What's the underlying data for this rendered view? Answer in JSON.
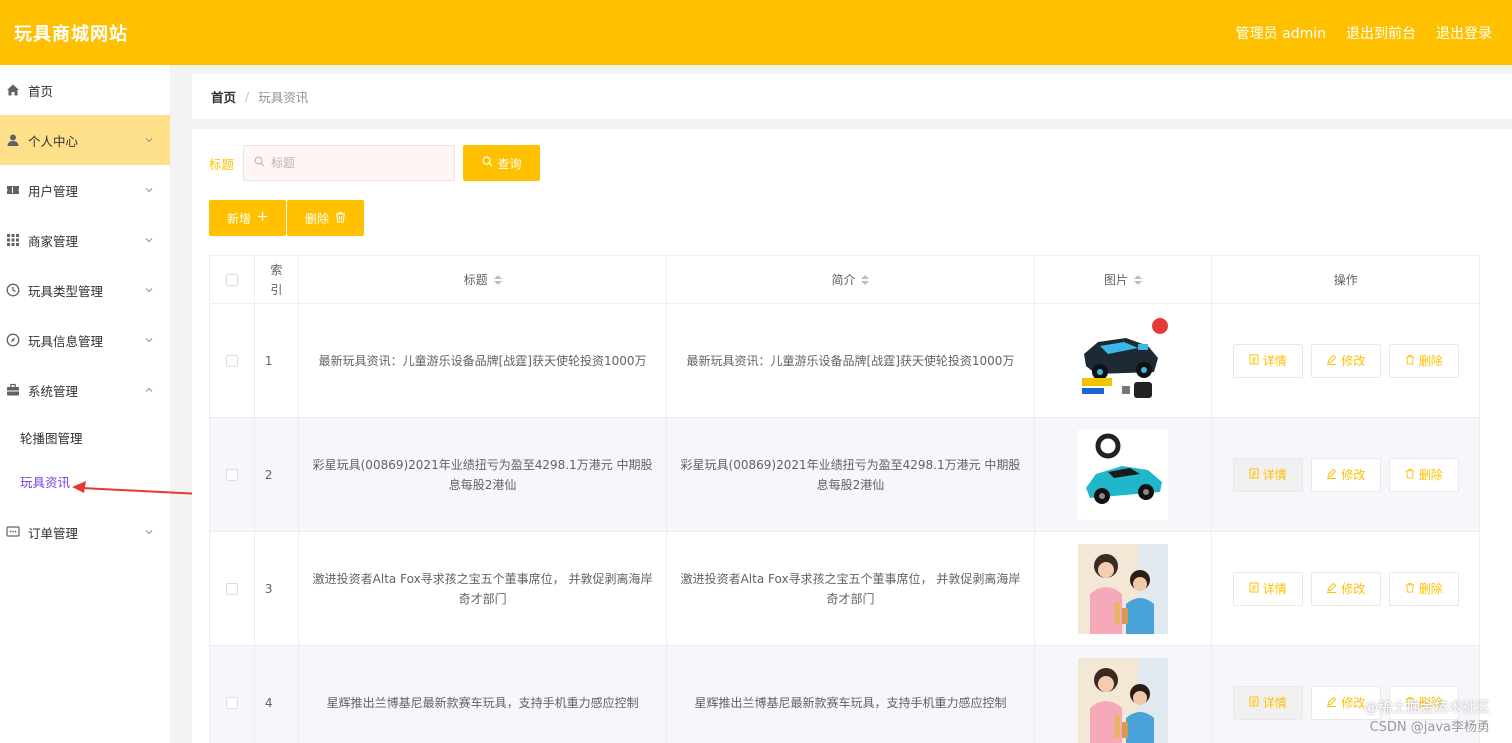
{
  "header": {
    "brand": "玩具商城网站",
    "admin_label": "管理员 admin",
    "to_front": "退出到前台",
    "logout": "退出登录"
  },
  "sidebar": {
    "items": [
      {
        "label": "首页",
        "icon": "home-icon"
      },
      {
        "label": "个人中心",
        "icon": "user-icon"
      },
      {
        "label": "用户管理",
        "icon": "ticket-icon"
      },
      {
        "label": "商家管理",
        "icon": "grid-icon"
      },
      {
        "label": "玩具类型管理",
        "icon": "clock-icon"
      },
      {
        "label": "玩具信息管理",
        "icon": "compass-icon"
      },
      {
        "label": "系统管理",
        "icon": "briefcase-icon"
      },
      {
        "label": "订单管理",
        "icon": "chat-icon"
      }
    ],
    "sub_items": [
      {
        "label": "轮播图管理"
      },
      {
        "label": "玩具资讯"
      }
    ]
  },
  "breadcrumb": {
    "home": "首页",
    "separator": "/",
    "current": "玩具资讯"
  },
  "search": {
    "label": "标题",
    "placeholder": "标题",
    "button": "查询"
  },
  "actions": {
    "add": "新增",
    "delete": "删除"
  },
  "table": {
    "headers": {
      "index": "索引",
      "title": "标题",
      "brief": "简介",
      "picture": "图片",
      "operation": "操作"
    },
    "rows": [
      {
        "index": "1",
        "title": "最新玩具资讯：儿童游乐设备品牌[战霆]获天使轮投资1000万",
        "brief": "最新玩具资讯：儿童游乐设备品牌[战霆]获天使轮投资1000万"
      },
      {
        "index": "2",
        "title": "彩星玩具(00869)2021年业绩扭亏为盈至4298.1万港元 中期股息每股2港仙",
        "brief": "彩星玩具(00869)2021年业绩扭亏为盈至4298.1万港元 中期股息每股2港仙"
      },
      {
        "index": "3",
        "title": "激进投资者Alta Fox寻求孩之宝五个董事席位， 并敦促剥离海岸奇才部门",
        "brief": "激进投资者Alta Fox寻求孩之宝五个董事席位， 并敦促剥离海岸奇才部门"
      },
      {
        "index": "4",
        "title": "星辉推出兰博基尼最新款赛车玩具，支持手机重力感应控制",
        "brief": "星辉推出兰博基尼最新款赛车玩具，支持手机重力感应控制"
      }
    ],
    "ops": {
      "detail": "详情",
      "edit": "修改",
      "remove": "删除"
    }
  },
  "watermark": {
    "line1": "@稀土掘金技术社区",
    "line2": "CSDN @java李杨勇"
  },
  "colors": {
    "accent": "#ffc000",
    "active_menu": "#ffe08a",
    "current_sub": "#7b3fe4"
  }
}
